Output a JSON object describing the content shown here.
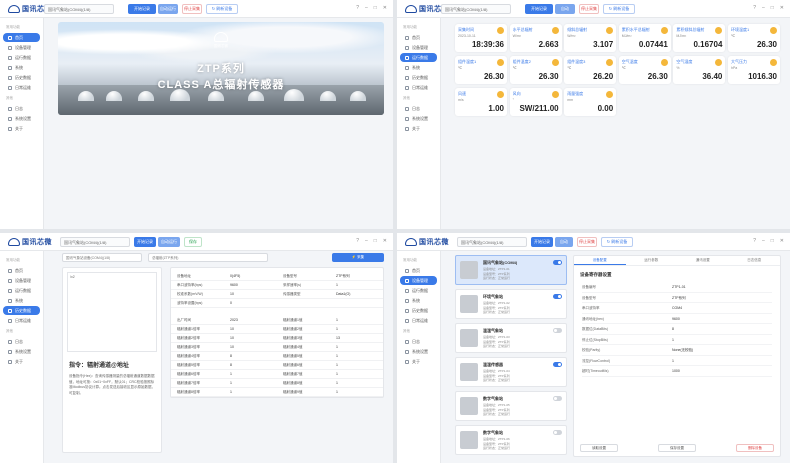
{
  "app": {
    "logo_text": "国讯芯微"
  },
  "pane1": {
    "device": "国讯气象站(COM4)(1/8)",
    "buttons": [
      "开始记录",
      "自动运行",
      "停止采集",
      "↻ 刷新设备"
    ],
    "sidebar": {
      "head1": "常用功能",
      "items": [
        "首页",
        "设备管理",
        "运行数据",
        "系统",
        "历史数据",
        "日常运维"
      ],
      "head2": "其他",
      "items2": [
        "日志",
        "系统设置",
        "关于"
      ]
    },
    "banner": {
      "logo_label": "国讯芯微",
      "title1": "ZTP系列",
      "title2": "CLASS A总辐射传感器"
    }
  },
  "pane2": {
    "device": "国讯气象站(COM4)(1/8)",
    "buttons": [
      "开始记录",
      "自动",
      "停止采集",
      "↻ 刷新设备"
    ],
    "sidebar": {
      "head1": "常用功能",
      "items": [
        "首页",
        "设备管理",
        "运行数据",
        "系统",
        "历史数据",
        "日常运维"
      ],
      "head2": "其他",
      "items2": [
        "日志",
        "系统设置",
        "关于"
      ]
    },
    "cards": [
      {
        "name": "采集时间",
        "unit": "2023-10-11",
        "value": "18:39:36"
      },
      {
        "name": "水平总辐射",
        "unit": "W/m²",
        "value": "2.663"
      },
      {
        "name": "倾斜总辐射",
        "unit": "W/m²",
        "value": "3.107"
      },
      {
        "name": "累积水平总辐射",
        "unit": "MJ/m²",
        "value": "0.07441"
      },
      {
        "name": "累积倾斜总辐射",
        "unit": "MJ/m²",
        "value": "0.16704"
      },
      {
        "name": "环境温度1",
        "unit": "℃",
        "value": "26.30"
      },
      {
        "name": "组件温度1",
        "unit": "℃",
        "value": "26.30"
      },
      {
        "name": "组件温度2",
        "unit": "℃",
        "value": "26.30"
      },
      {
        "name": "组件温度3",
        "unit": "℃",
        "value": "26.20"
      },
      {
        "name": "空气温度",
        "unit": "℃",
        "value": "26.30"
      },
      {
        "name": "空气湿度",
        "unit": "%",
        "value": "36.40"
      },
      {
        "name": "大气压力",
        "unit": "hPa",
        "value": "1016.30"
      },
      {
        "name": "风速",
        "unit": "m/s",
        "value": "1.00"
      },
      {
        "name": "风向",
        "unit": "°",
        "value": "SW/211.00"
      },
      {
        "name": "雨量强度",
        "unit": "mm",
        "value": "0.00"
      }
    ]
  },
  "pane3": {
    "device": "国讯气象站(COM4)(1/8)",
    "buttons": [
      "开始记录",
      "自动运行",
      "保存"
    ],
    "search1": "国讯气象站设备(COM4)(1/8)",
    "search2": "总辐射(ZTP系列)",
    "btn": "⚡ 采集",
    "textarea": "/x2",
    "heading": "指令：辐射通道@地址",
    "desc": "设备指令(Hex)：查询传感器测量的总辐射通道数据数据值，地址可按：0x01~0xFF，默认01；CRC校验按照标准Modbus协议计算。点击发送后接收区显示原始数据，可复制。",
    "sidebar": {
      "head1": "常用功能",
      "items": [
        "首页",
        "设备管理",
        "运行数据",
        "系统",
        "历史数据",
        "日常运维"
      ],
      "head2": "其他",
      "items2": [
        "日志",
        "系统设置",
        "关于"
      ]
    },
    "top_kv": [
      "设备地址",
      "0(4F5)",
      "设备型号",
      "ZTP系列",
      "串口波特率(bps)",
      "9600",
      "采样速率(s)",
      "1",
      "校准系数(mV/W)",
      "10",
      "传感器类型",
      "Data1(O)",
      "波特率设置(bps)",
      "0",
      "",
      ""
    ],
    "bottom_kv": [
      "出厂时间",
      "2023",
      "辐射通道1值",
      "1",
      "辐射通道1倍率",
      "10",
      "辐射通道2值",
      "1",
      "辐射通道2倍率",
      "10",
      "辐射通道3值",
      "13",
      "辐射通道3倍率",
      "10",
      "辐射通道4值",
      "1",
      "辐射通道4倍率",
      "8",
      "辐射通道5值",
      "1",
      "辐射通道5倍率",
      "8",
      "辐射通道6值",
      "1",
      "辐射通道6倍率",
      "1",
      "辐射通道7值",
      "1",
      "辐射通道7倍率",
      "1",
      "辐射通道8值",
      "1",
      "辐射通道8倍率",
      "1",
      "辐射通道9值",
      "1"
    ]
  },
  "pane4": {
    "device": "国讯气象站(COM4)(1/8)",
    "buttons": [
      "开始记录",
      "自动",
      "停止采集",
      "↻ 刷新设备"
    ],
    "sidebar": {
      "head1": "常用功能",
      "items": [
        "首页",
        "设备管理",
        "运行数据",
        "系统",
        "历史数据",
        "日常运维"
      ],
      "head2": "其他",
      "items2": [
        "日志",
        "系统设置",
        "关于"
      ]
    },
    "devices": [
      {
        "name": "国讯气象站(COM4)",
        "meta": [
          "设备地址：ZTP1-01",
          "设备型号：ZTP系列",
          "运行状态：正常运行"
        ],
        "on": true,
        "sel": true
      },
      {
        "name": "环境气象站",
        "meta": [
          "设备地址：ZTP1-02",
          "设备型号：ZTP系列",
          "运行状态：正常运行"
        ],
        "on": true,
        "sel": false
      },
      {
        "name": "温湿气象站",
        "meta": [
          "设备地址：ZTP1-03",
          "设备型号：ZTP系列",
          "运行状态：正常运行"
        ],
        "on": false,
        "sel": false
      },
      {
        "name": "温湿传感器",
        "meta": [
          "设备地址：ZTP1-04",
          "设备型号：ZTP系列",
          "运行状态：正常运行"
        ],
        "on": true,
        "sel": false
      },
      {
        "name": "数字气象站",
        "meta": [
          "设备地址：ZTP1-05",
          "设备型号：ZTP系列",
          "运行状态：正常运行"
        ],
        "on": false,
        "sel": false
      },
      {
        "name": "数字气象站",
        "meta": [
          "设备地址：ZTP1-06",
          "设备型号：ZTP系列",
          "运行状态：正常运行"
        ],
        "on": false,
        "sel": false
      }
    ],
    "tabs": [
      "设备配置",
      "运行参数",
      "通讯设置",
      "日志信息"
    ],
    "detail_title": "设备寄存器设置",
    "rows": [
      [
        "设备编号",
        "ZTP1-01"
      ],
      [
        "设备型号",
        "ZTP系列"
      ],
      [
        "串口波特率",
        "COM4"
      ],
      [
        "通讯地址(hex)",
        "9600"
      ],
      [
        "数据位(DataBits)",
        "8"
      ],
      [
        "停止位(StopBits)",
        "1"
      ],
      [
        "校验(Parity)",
        "None(无校验)"
      ],
      [
        "流控(FlowControl)",
        "1"
      ],
      [
        "超时(TimeoutMs)",
        "1000"
      ]
    ],
    "dbtns": [
      "读取设置",
      "保存设置",
      "删除设备"
    ]
  }
}
